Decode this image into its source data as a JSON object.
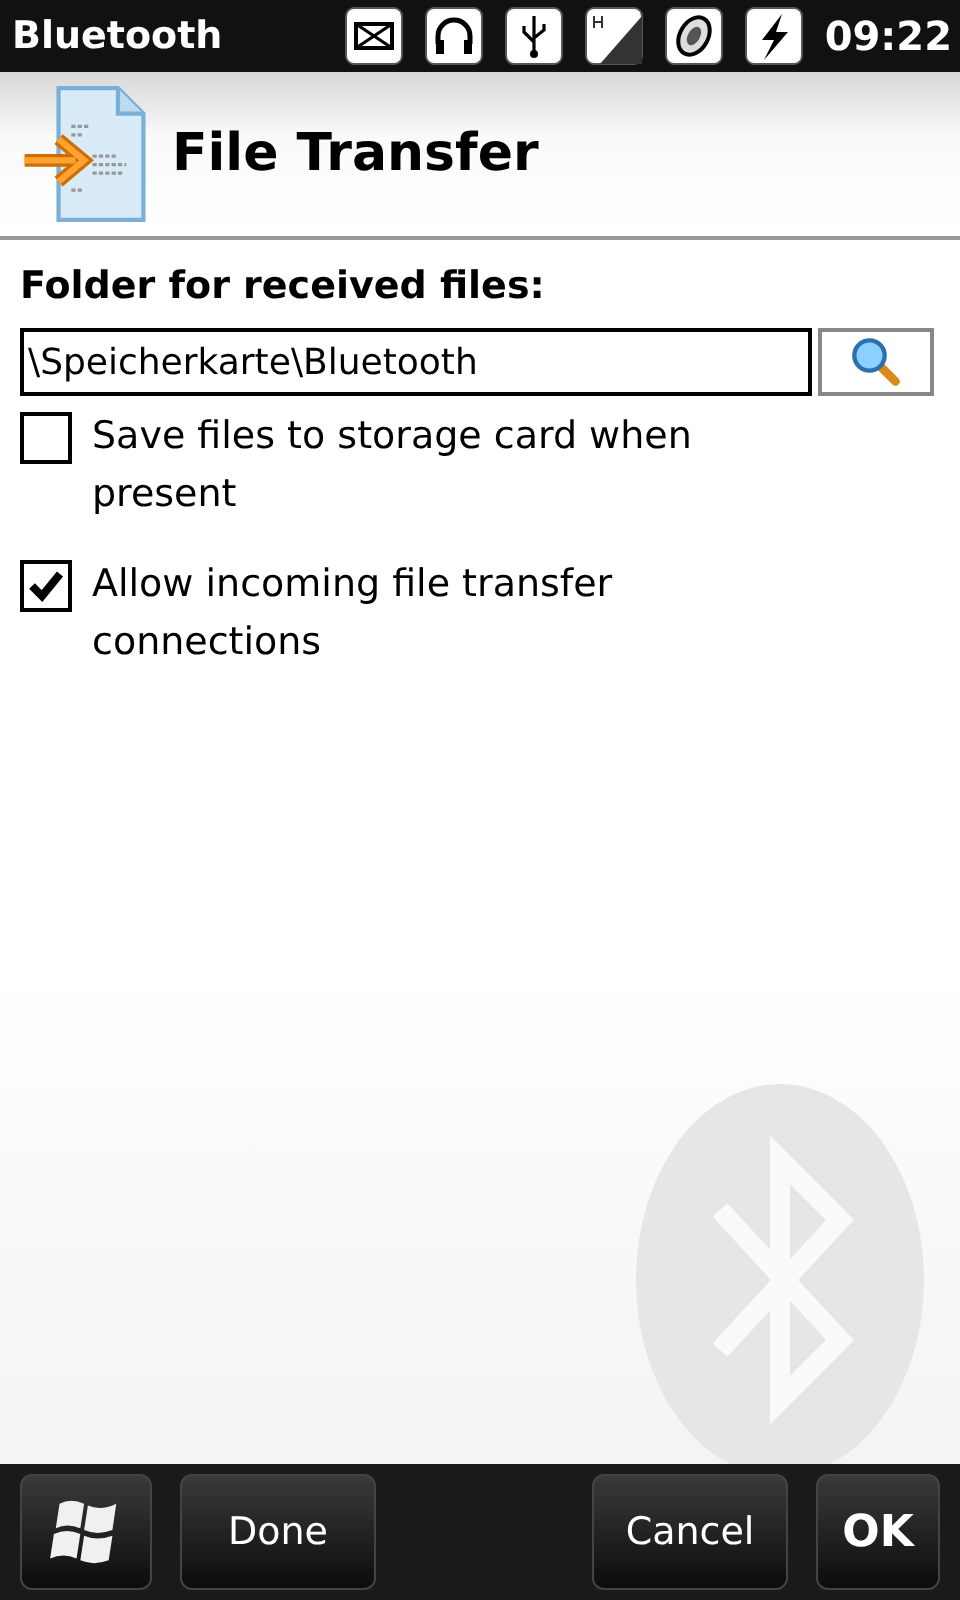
{
  "status_bar": {
    "title": "Bluetooth",
    "time": "09:22"
  },
  "header": {
    "title": "File Transfer"
  },
  "folder": {
    "label": "Folder for received files:",
    "value": "\\Speicherkarte\\Bluetooth"
  },
  "options": [
    {
      "label": "Save files to storage card when present",
      "checked": false
    },
    {
      "label": "Allow incoming file transfer connections",
      "checked": true
    }
  ],
  "softkeys": [
    {
      "kind": "start"
    },
    {
      "kind": "text",
      "label": "Done"
    },
    {
      "kind": "text",
      "label": "Cancel"
    },
    {
      "kind": "bold",
      "label": "OK"
    }
  ]
}
